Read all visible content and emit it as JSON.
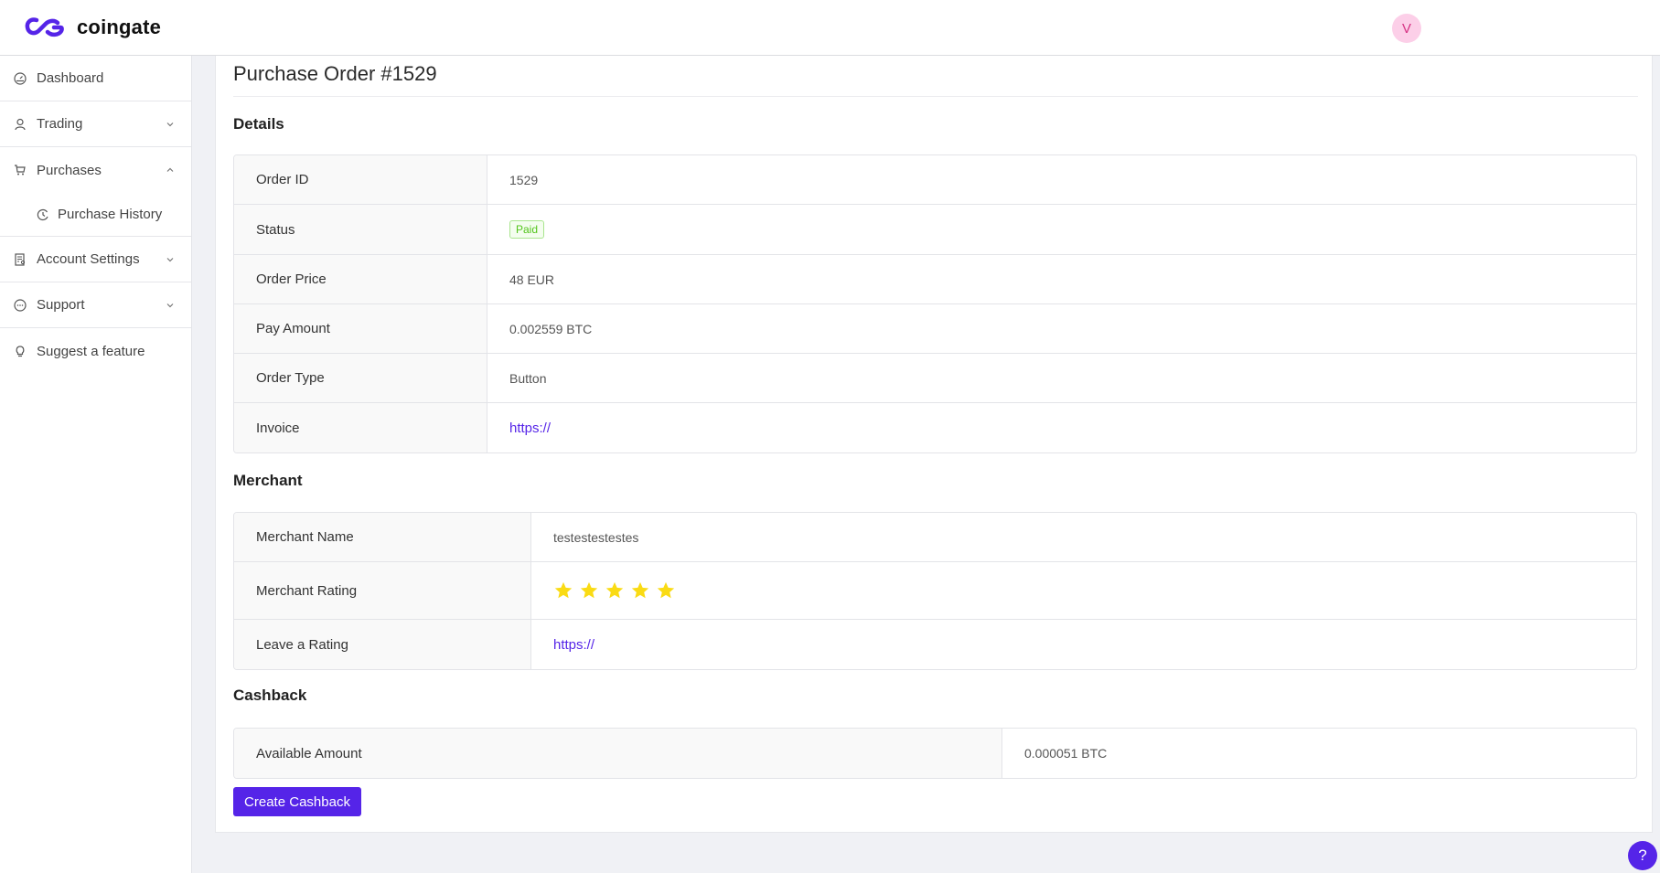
{
  "header": {
    "brand": "coingate",
    "avatar_initial": "V",
    "brand_color": "#5524e8"
  },
  "sidebar": {
    "items": [
      {
        "label": "Dashboard",
        "icon": "dashboard-icon"
      },
      {
        "label": "Trading",
        "icon": "user-icon",
        "expandable": true,
        "expanded": false
      },
      {
        "label": "Purchases",
        "icon": "cart-icon",
        "expandable": true,
        "expanded": true,
        "children": [
          {
            "label": "Purchase History",
            "icon": "history-icon"
          }
        ]
      },
      {
        "label": "Account Settings",
        "icon": "account-settings-icon",
        "expandable": true,
        "expanded": false
      },
      {
        "label": "Support",
        "icon": "chat-icon",
        "expandable": true,
        "expanded": false
      },
      {
        "label": "Suggest a feature",
        "icon": "lightbulb-icon"
      }
    ]
  },
  "page": {
    "title": "Purchase Order #1529"
  },
  "details": {
    "title": "Details",
    "rows": [
      {
        "label": "Order ID",
        "value": "1529"
      },
      {
        "label": "Status",
        "value": "Paid"
      },
      {
        "label": "Order Price",
        "value": "48 EUR"
      },
      {
        "label": "Pay Amount",
        "value": "0.002559 BTC"
      },
      {
        "label": "Order Type",
        "value": "Button"
      },
      {
        "label": "Invoice",
        "value": "https://"
      }
    ]
  },
  "merchant": {
    "title": "Merchant",
    "rows": [
      {
        "label": "Merchant Name",
        "value": "testestestestes"
      },
      {
        "label": "Merchant Rating",
        "value": "5",
        "rating": 5,
        "max_rating": 5
      },
      {
        "label": "Leave a Rating",
        "value": "https://"
      }
    ]
  },
  "cashback": {
    "title": "Cashback",
    "rows": [
      {
        "label": "Available Amount",
        "value": "0.000051 BTC"
      }
    ],
    "button_label": "Create Cashback"
  },
  "help": {
    "label": "?"
  },
  "colors": {
    "accent": "#5524e8",
    "status_paid": "#52c41a",
    "star": "#fadb14",
    "avatar_bg": "#fccfe8"
  }
}
